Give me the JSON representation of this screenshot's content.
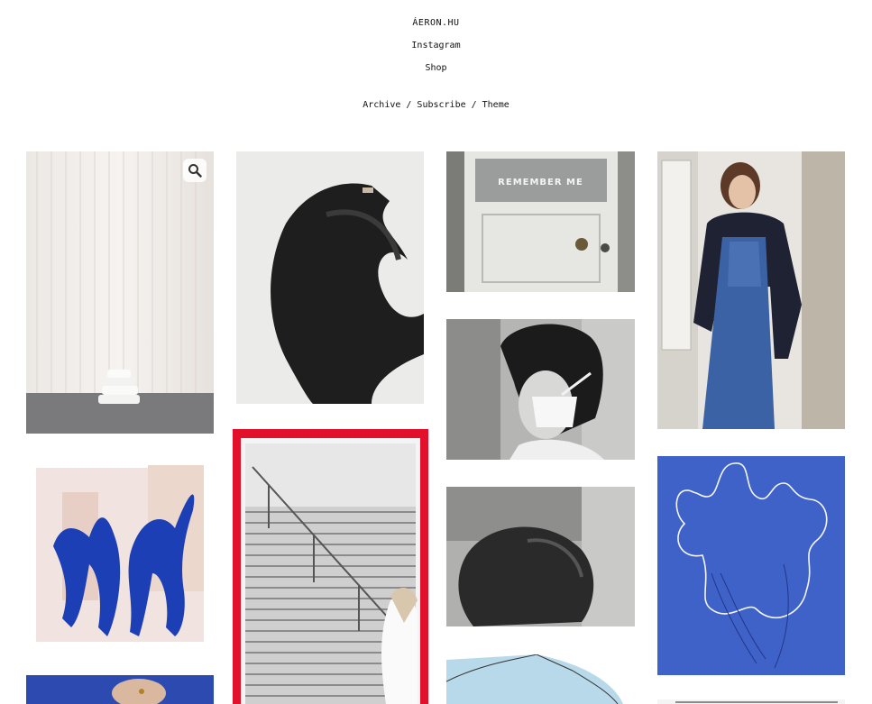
{
  "header": {
    "site_title": "ÁERON.HU",
    "links": [
      "Instagram",
      "Shop"
    ],
    "nav": [
      "Archive",
      "Subscribe",
      "Theme"
    ],
    "nav_separator": "/"
  },
  "gallery": {
    "door_sign_text": "REMEMBER ME",
    "zoom_icon": "magnifier-icon"
  },
  "colors": {
    "accent_red": "#e2102b",
    "klein_blue": "#1d3fb5",
    "paper_blue": "#3f62c9"
  }
}
